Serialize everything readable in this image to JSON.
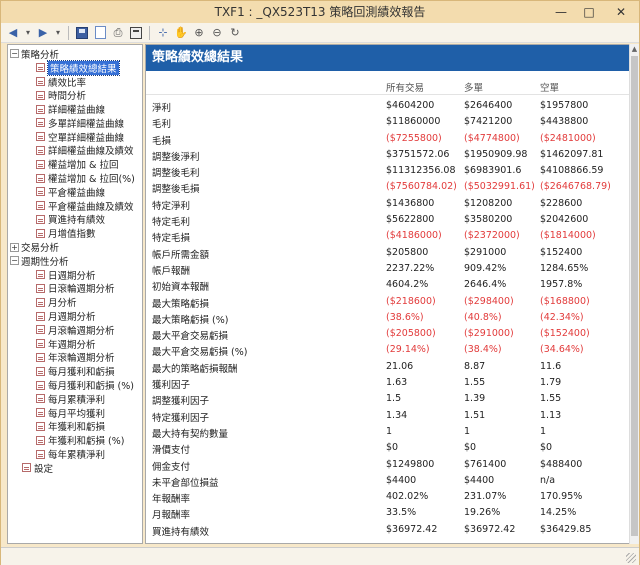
{
  "window": {
    "title": "TXF1 : _QX523T13 策略回測績效報告"
  },
  "titlebar_controls": {
    "minimize": "—",
    "maximize": "□",
    "close": "✕"
  },
  "toolbar": {
    "back": "◆",
    "forward": "◆",
    "dropdown": "▾",
    "save_icon": "save-icon",
    "report_icon": "report-icon",
    "print_icon": "print-icon",
    "calculator_icon": "calculator-icon",
    "cursor": "⊹",
    "hand": "✋",
    "zoom_in": "⊕",
    "zoom_out": "⊖",
    "refresh": "↻"
  },
  "tree": {
    "strategy_analysis": "策略分析",
    "strategy_items": [
      "策略績效總結果",
      "績效比率",
      "時間分析",
      "詳細權益曲線",
      "多單詳細權益曲線",
      "空單詳細權益曲線",
      "詳細權益曲線及績效",
      "權益增加 & 拉回",
      "權益增加 & 拉回(%)",
      "平倉權益曲線",
      "平倉權益曲線及績效",
      "買進持有績效",
      "月增值指數"
    ],
    "trade_analysis": "交易分析",
    "period_analysis": "週期性分析",
    "period_items": [
      "日週期分析",
      "日滾輪週期分析",
      "月分析",
      "月週期分析",
      "月滾輪週期分析",
      "年週期分析",
      "年滾輪週期分析",
      "每月獲利和虧損",
      "每月獲利和虧損 (%)",
      "每月累積淨利",
      "每月平均獲利",
      "年獲利和虧損",
      "年獲利和虧損 (%)",
      "每年累積淨利"
    ],
    "settings": "設定"
  },
  "report": {
    "header": "策略績效總結果",
    "columns": [
      "所有交易",
      "多單",
      "空單"
    ],
    "rows": [
      {
        "label": "淨利",
        "all": "$4604200",
        "long": "$2646400",
        "short": "$1957800",
        "neg": false
      },
      {
        "label": "毛利",
        "all": "$11860000",
        "long": "$7421200",
        "short": "$4438800",
        "neg": false
      },
      {
        "label": "毛損",
        "all": "($7255800)",
        "long": "($4774800)",
        "short": "($2481000)",
        "neg": true
      },
      {
        "label": "調整後淨利",
        "all": "$3751572.06",
        "long": "$1950909.98",
        "short": "$1462097.81",
        "neg": false
      },
      {
        "label": "調整後毛利",
        "all": "$11312356.08",
        "long": "$6983901.6",
        "short": "$4108866.59",
        "neg": false
      },
      {
        "label": "調整後毛損",
        "all": "($7560784.02)",
        "long": "($5032991.61)",
        "short": "($2646768.79)",
        "neg": true
      },
      {
        "label": "特定淨利",
        "all": "$1436800",
        "long": "$1208200",
        "short": "$228600",
        "neg": false
      },
      {
        "label": "特定毛利",
        "all": "$5622800",
        "long": "$3580200",
        "short": "$2042600",
        "neg": false
      },
      {
        "label": "特定毛損",
        "all": "($4186000)",
        "long": "($2372000)",
        "short": "($1814000)",
        "neg": true
      },
      {
        "label": "帳戶所需金額",
        "all": "$205800",
        "long": "$291000",
        "short": "$152400",
        "neg": false
      },
      {
        "label": "帳戶報酬",
        "all": "2237.22%",
        "long": "909.42%",
        "short": "1284.65%",
        "neg": false
      },
      {
        "label": "初始資本報酬",
        "all": "4604.2%",
        "long": "2646.4%",
        "short": "1957.8%",
        "neg": false
      },
      {
        "label": "最大策略虧損",
        "all": "($218600)",
        "long": "($298400)",
        "short": "($168800)",
        "neg": true
      },
      {
        "label": "最大策略虧損 (%)",
        "all": "(38.6%)",
        "long": "(40.8%)",
        "short": "(42.34%)",
        "neg": true
      },
      {
        "label": "最大平倉交易虧損",
        "all": "($205800)",
        "long": "($291000)",
        "short": "($152400)",
        "neg": true
      },
      {
        "label": "最大平倉交易虧損 (%)",
        "all": "(29.14%)",
        "long": "(38.4%)",
        "short": "(34.64%)",
        "neg": true
      },
      {
        "label": "最大的策略虧損報酬",
        "all": "21.06",
        "long": "8.87",
        "short": "11.6",
        "neg": false
      },
      {
        "label": "獲利因子",
        "all": "1.63",
        "long": "1.55",
        "short": "1.79",
        "neg": false
      },
      {
        "label": "調整獲利因子",
        "all": "1.5",
        "long": "1.39",
        "short": "1.55",
        "neg": false
      },
      {
        "label": "特定獲利因子",
        "all": "1.34",
        "long": "1.51",
        "short": "1.13",
        "neg": false
      },
      {
        "label": "最大持有契約數量",
        "all": "1",
        "long": "1",
        "short": "1",
        "neg": false
      },
      {
        "label": "滑價支付",
        "all": "$0",
        "long": "$0",
        "short": "$0",
        "neg": false
      },
      {
        "label": "佣金支付",
        "all": "$1249800",
        "long": "$761400",
        "short": "$488400",
        "neg": false
      },
      {
        "label": "未平倉部位損益",
        "all": "$4400",
        "long": "$4400",
        "short": "n/a",
        "neg": false
      },
      {
        "label": "年報酬率",
        "all": "402.02%",
        "long": "231.07%",
        "short": "170.95%",
        "neg": false
      },
      {
        "label": "月報酬率",
        "all": "33.5%",
        "long": "19.26%",
        "short": "14.25%",
        "neg": false
      },
      {
        "label": "買進持有績效",
        "all": "$36972.42",
        "long": "$36972.42",
        "short": "$36429.85",
        "neg": false
      }
    ]
  },
  "colors": {
    "header_bg": "#1f5fa8",
    "negative": "#e23b3b",
    "title_bg": "#f3dcae",
    "selection": "#3670d6"
  }
}
